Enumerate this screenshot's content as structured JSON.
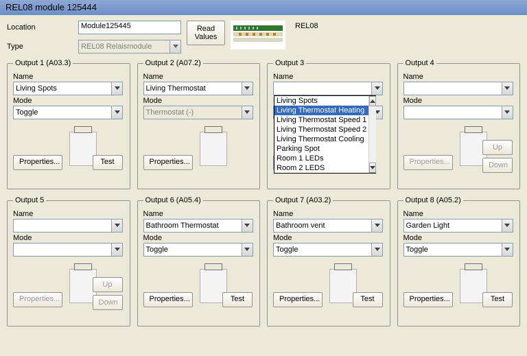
{
  "window": {
    "title": "REL08 module 125444"
  },
  "header": {
    "location_label": "Location",
    "location_value": "Module125445",
    "type_label": "Type",
    "type_value": "REL08 Relaismodule",
    "read_values": "Read\nValues",
    "module_name": "REL08"
  },
  "labels": {
    "name": "Name",
    "mode": "Mode",
    "properties": "Properties...",
    "test": "Test",
    "up": "Up",
    "down": "Down"
  },
  "outputs": [
    {
      "legend": "Output 1 (A03.3)",
      "name": "Living Spots",
      "mode": "Toggle",
      "mode_disabled": false,
      "properties_disabled": false,
      "has_test": true,
      "has_updown": false
    },
    {
      "legend": "Output 2 (A07.2)",
      "name": "Living Thermostat",
      "mode": "Thermostat (-)",
      "mode_disabled": true,
      "properties_disabled": false,
      "has_test": false,
      "has_updown": false
    },
    {
      "legend": "Output 3",
      "name": "",
      "mode": "",
      "mode_disabled": false,
      "properties_disabled": true,
      "has_test": false,
      "has_updown": false,
      "open_dropdown": true
    },
    {
      "legend": "Output 4",
      "name": "",
      "mode": "",
      "mode_disabled": false,
      "properties_disabled": true,
      "has_test": false,
      "has_updown": true,
      "updown_disabled": true
    },
    {
      "legend": "Output 5",
      "name": "",
      "mode": "",
      "mode_disabled": false,
      "properties_disabled": true,
      "has_test": false,
      "has_updown": true,
      "updown_disabled": true
    },
    {
      "legend": "Output 6 (A05.4)",
      "name": "Bathroom Thermostat",
      "mode": "Toggle",
      "mode_disabled": false,
      "properties_disabled": false,
      "has_test": true,
      "has_updown": false
    },
    {
      "legend": "Output 7 (A03.2)",
      "name": "Bathroom vent",
      "mode": "Toggle",
      "mode_disabled": false,
      "properties_disabled": false,
      "has_test": true,
      "has_updown": false
    },
    {
      "legend": "Output 8 (A05.2)",
      "name": "Garden Light",
      "mode": "Toggle",
      "mode_disabled": false,
      "properties_disabled": false,
      "has_test": true,
      "has_updown": false
    }
  ],
  "dropdown": {
    "items": [
      "Living Spots",
      "Living Thermostat Heating",
      "Living Thermostat Speed 1",
      "Living Thermostat Speed 2",
      "Living Thermostat Cooling",
      "Parking Spot",
      "Room 1 LEDs",
      "Room 2 LEDS"
    ],
    "selected_index": 1
  }
}
